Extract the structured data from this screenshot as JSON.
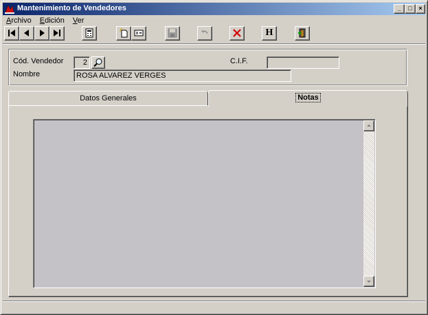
{
  "window": {
    "title": "Mantenimiento de Vendedores",
    "controls": {
      "minimize": "_",
      "maximize": "□",
      "close": "×"
    }
  },
  "menu": {
    "items": [
      {
        "first": "A",
        "rest": "rchivo"
      },
      {
        "first": "E",
        "rest": "dición"
      },
      {
        "first": "V",
        "rest": "er"
      }
    ]
  },
  "toolbar": {
    "icons": [
      "first-record-icon",
      "previous-record-icon",
      "next-record-icon",
      "last-record-icon",
      "calculator-icon",
      "new-record-icon",
      "edit-record-icon",
      "save-icon",
      "undo-icon",
      "delete-icon",
      "history-icon",
      "exit-icon"
    ],
    "history_label": "H"
  },
  "form": {
    "cod_vendedor_label": "Cód. Vendedor",
    "cod_vendedor_value": "2",
    "cif_label": "C.I.F.",
    "cif_value": "",
    "nombre_label": "Nombre",
    "nombre_value": "ROSA ALVAREZ VERGES"
  },
  "tabs": {
    "items": [
      {
        "label": "Datos Generales",
        "active": false
      },
      {
        "label": "Notas",
        "active": true
      }
    ]
  },
  "notes": {
    "value": ""
  },
  "colors": {
    "title_start": "#0a246a",
    "title_end": "#a6caf0",
    "face": "#d4d0c8",
    "notes_bg": "#c4c2c6",
    "delete_red": "#d00000"
  }
}
